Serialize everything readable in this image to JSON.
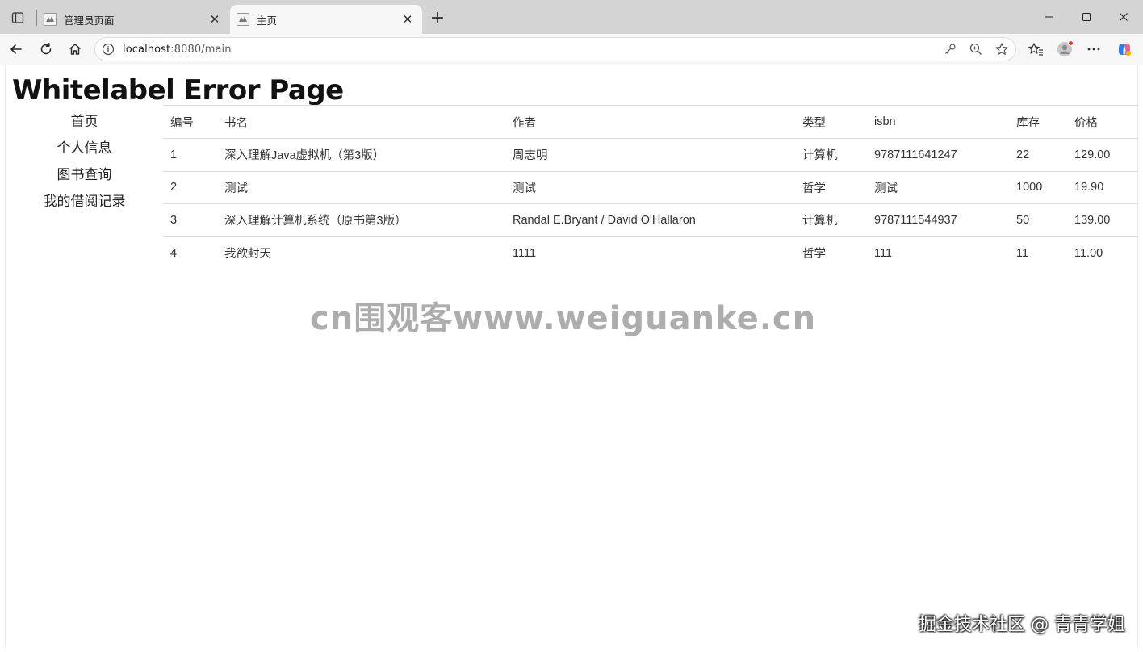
{
  "browser": {
    "tabs": [
      {
        "title": "管理员页面",
        "active": false
      },
      {
        "title": "主页",
        "active": true
      }
    ],
    "address": {
      "host": "localhost",
      "path": ":8080/main"
    }
  },
  "page": {
    "error_title": "Whitelabel Error Page",
    "nav": [
      "首页",
      "个人信息",
      "图书查询",
      "我的借阅记录"
    ],
    "table": {
      "headers": [
        "编号",
        "书名",
        "作者",
        "类型",
        "isbn",
        "库存",
        "价格"
      ],
      "rows": [
        [
          "1",
          "深入理解Java虚拟机（第3版）",
          "周志明",
          "计算机",
          "9787111641247",
          "22",
          "129.00"
        ],
        [
          "2",
          "测试",
          "测试",
          "哲学",
          "测试",
          "1000",
          "19.90"
        ],
        [
          "3",
          "深入理解计算机系统（原书第3版）",
          "Randal E.Bryant / David O'Hallaron",
          "计算机",
          "9787111544937",
          "50",
          "139.00"
        ],
        [
          "4",
          "我欲封天",
          "1111",
          "哲学",
          "111",
          "11",
          "11.00"
        ]
      ]
    }
  },
  "watermarks": {
    "center": "cn围观客www.weiguanke.cn",
    "corner": "掘金技术社区 @ 青青学姐"
  },
  "icons": [
    "sidebar-toggle-icon",
    "favicon-icon",
    "close-icon",
    "plus-icon",
    "minimize-icon",
    "maximize-icon",
    "back-icon",
    "refresh-icon",
    "home-icon",
    "info-icon",
    "key-icon",
    "zoom-icon",
    "star-icon",
    "favorites-icon",
    "avatar-icon",
    "more-icon",
    "copilot-icon"
  ]
}
